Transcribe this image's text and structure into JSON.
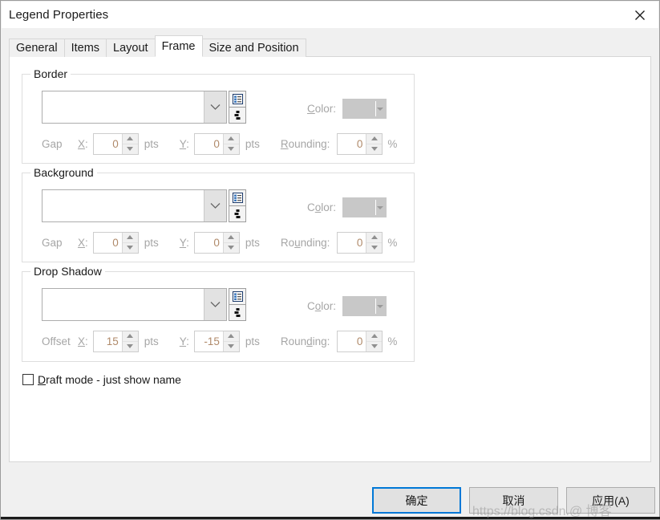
{
  "window": {
    "title": "Legend Properties",
    "close_icon": "close-icon"
  },
  "tabs": [
    {
      "label": "General",
      "selected": false
    },
    {
      "label": "Items",
      "selected": false
    },
    {
      "label": "Layout",
      "selected": false
    },
    {
      "label": "Frame",
      "selected": true
    },
    {
      "label": "Size and Position",
      "selected": false
    }
  ],
  "groups": [
    {
      "id": "border",
      "title": "Border",
      "combo": {
        "value": "",
        "arrow_icon": "chevron-down-icon"
      },
      "side_buttons": [
        {
          "icon": "properties-list-icon"
        },
        {
          "icon": "expression-builder-icon"
        }
      ],
      "color": {
        "label_pre": "",
        "label_accel": "C",
        "label_post": "olor:",
        "value": "#c8c8c8",
        "disabled": true
      },
      "offset_label": "Gap",
      "x_label_accel": "X",
      "x_label_post": ":",
      "x_value": "0",
      "x_units": "pts",
      "y_label_accel": "Y",
      "y_label_post": ":",
      "y_value": "0",
      "y_units": "pts",
      "rounding_pre": "",
      "rounding_accel": "R",
      "rounding_post": "ounding:",
      "rounding_value": "0",
      "rounding_units": "%"
    },
    {
      "id": "background",
      "title": "Background",
      "combo": {
        "value": "",
        "arrow_icon": "chevron-down-icon"
      },
      "side_buttons": [
        {
          "icon": "properties-list-icon"
        },
        {
          "icon": "expression-builder-icon"
        }
      ],
      "color": {
        "label_pre": "C",
        "label_accel": "o",
        "label_post": "lor:",
        "value": "#c8c8c8",
        "disabled": true
      },
      "offset_label": "Gap",
      "x_label_accel": "X",
      "x_label_post": ":",
      "x_value": "0",
      "x_units": "pts",
      "y_label_accel": "Y",
      "y_label_post": ":",
      "y_value": "0",
      "y_units": "pts",
      "rounding_pre": "Ro",
      "rounding_accel": "u",
      "rounding_post": "nding:",
      "rounding_value": "0",
      "rounding_units": "%"
    },
    {
      "id": "dropshadow",
      "title": "Drop Shadow",
      "combo": {
        "value": "",
        "arrow_icon": "chevron-down-icon"
      },
      "side_buttons": [
        {
          "icon": "properties-list-icon"
        },
        {
          "icon": "expression-builder-icon"
        }
      ],
      "color": {
        "label_pre": "C",
        "label_accel": "o",
        "label_post": "lor:",
        "value": "#c8c8c8",
        "disabled": true
      },
      "offset_label": "Offset",
      "x_label_accel": "X",
      "x_label_post": ":",
      "x_value": "15",
      "x_units": "pts",
      "y_label_accel": "Y",
      "y_label_post": ":",
      "y_value": "-15",
      "y_units": "pts",
      "rounding_pre": "Roun",
      "rounding_accel": "d",
      "rounding_post": "ing:",
      "rounding_value": "0",
      "rounding_units": "%"
    }
  ],
  "draft_mode": {
    "checked": false,
    "label_accel": "D",
    "label_post": "raft mode - just show name"
  },
  "footer": {
    "ok_label": "确定",
    "cancel_label": "取消",
    "apply_label": "应用(A)",
    "focused": "ok",
    "accent_color": "#0078d7"
  },
  "watermark": {
    "text": "https://blog.csdn.@ 博客"
  }
}
